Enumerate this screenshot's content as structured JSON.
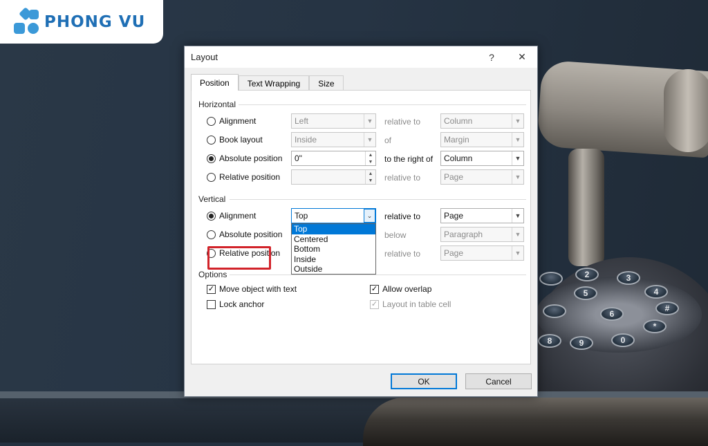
{
  "brand": {
    "logo_text": "PHONG VU"
  },
  "dialog": {
    "title": "Layout",
    "help_label": "?",
    "close_label": "✕",
    "tabs": [
      {
        "label": "Position",
        "active": true
      },
      {
        "label": "Text Wrapping",
        "active": false
      },
      {
        "label": "Size",
        "active": false
      }
    ],
    "horizontal": {
      "label": "Horizontal",
      "alignment": {
        "label": "Alignment",
        "value": "Left",
        "relation": "relative to",
        "target": "Column"
      },
      "book_layout": {
        "label": "Book layout",
        "value": "Inside",
        "relation": "of",
        "target": "Margin"
      },
      "absolute_position": {
        "label": "Absolute position",
        "value": "0\"",
        "relation": "to the right of",
        "target": "Column",
        "checked": true
      },
      "relative_position": {
        "label": "Relative position",
        "value": "",
        "relation": "relative to",
        "target": "Page"
      }
    },
    "vertical": {
      "label": "Vertical",
      "alignment": {
        "label": "Alignment",
        "value": "Top",
        "relation": "relative to",
        "target": "Page",
        "checked": true
      },
      "absolute_position": {
        "label": "Absolute position",
        "relation": "below",
        "target": "Paragraph"
      },
      "relative_position": {
        "label": "Relative position",
        "relation": "relative to",
        "target": "Page"
      },
      "dropdown_options": [
        "Top",
        "Centered",
        "Bottom",
        "Inside",
        "Outside"
      ],
      "dropdown_selected": "Top"
    },
    "options": {
      "label": "Options",
      "move_object": {
        "label": "Move object with text",
        "checked": true
      },
      "lock_anchor": {
        "label": "Lock anchor",
        "checked": false
      },
      "allow_overlap": {
        "label": "Allow overlap",
        "checked": true
      },
      "layout_in_table": {
        "label": "Layout in table cell",
        "checked": true,
        "disabled": true
      }
    },
    "ok_label": "OK",
    "cancel_label": "Cancel"
  },
  "phone": {
    "keys": [
      "2",
      "2",
      "3",
      "4",
      "#",
      "5",
      "6",
      "*",
      "8",
      "9",
      "0"
    ]
  }
}
